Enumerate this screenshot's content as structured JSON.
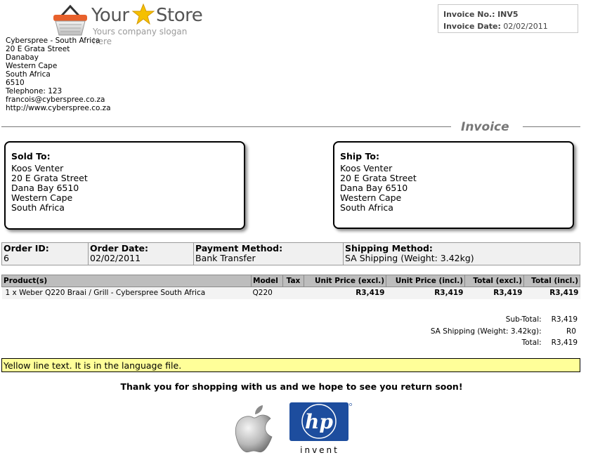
{
  "logo": {
    "word1": "Your",
    "word2": "Store",
    "slogan": "Yours company slogan here"
  },
  "invoice_info": {
    "number_label": "Invoice No.:",
    "number": "INV5",
    "date_label": "Invoice Date:",
    "date": "02/02/2011"
  },
  "store": {
    "lines": [
      "Cyberspree - South Africa",
      "20 E Grata Street",
      "Danabay",
      "Western Cape",
      "South Africa",
      "6510",
      "Telephone: 123",
      "francois@cyberspree.co.za",
      "http://www.cyberspree.co.za"
    ]
  },
  "invoice_title": "Invoice",
  "sold_to": {
    "heading": "Sold To:",
    "lines": [
      "Koos Venter",
      "20 E Grata Street",
      "Dana Bay 6510",
      "Western Cape",
      "South Africa"
    ]
  },
  "ship_to": {
    "heading": "Ship To:",
    "lines": [
      "Koos Venter",
      "20 E Grata Street",
      "Dana Bay 6510",
      "Western Cape",
      "South Africa"
    ]
  },
  "order": {
    "id_label": "Order ID:",
    "id": "6",
    "date_label": "Order Date:",
    "date": "02/02/2011",
    "payment_label": "Payment Method:",
    "payment": "Bank Transfer",
    "shipping_label": "Shipping Method:",
    "shipping": "SA Shipping (Weight: 3.42kg)"
  },
  "products": {
    "headers": {
      "product": "Product(s)",
      "model": "Model",
      "tax": "Tax",
      "unit_excl": "Unit Price (excl.)",
      "unit_incl": "Unit Price (incl.)",
      "total_excl": "Total (excl.)",
      "total_incl": "Total (incl.)"
    },
    "rows": [
      {
        "product": "1 x Weber Q220 Braai / Grill - Cyberspree South Africa",
        "model": "Q220",
        "tax": "",
        "unit_excl": "R3,419",
        "unit_incl": "R3,419",
        "total_excl": "R3,419",
        "total_incl": "R3,419"
      }
    ]
  },
  "totals": {
    "subtotal_label": "Sub-Total:",
    "subtotal": "R3,419",
    "shipping_label": "SA Shipping (Weight: 3.42kg):",
    "shipping": "R0",
    "total_label": "Total:",
    "total": "R3,419"
  },
  "yellow_line": "Yellow line text. It is in the language file.",
  "thanks": "Thank you for shopping with us and we hope to see you return soon!",
  "hp_logo_text": "hp",
  "hp_tagline": "invent",
  "colors": {
    "yellow_bg": "#ffff99",
    "table_header_bg": "#bdbdbd",
    "hp_blue": "#1d4d9e",
    "star_gold": "#f5c000",
    "basket_orange": "#e8612c"
  }
}
